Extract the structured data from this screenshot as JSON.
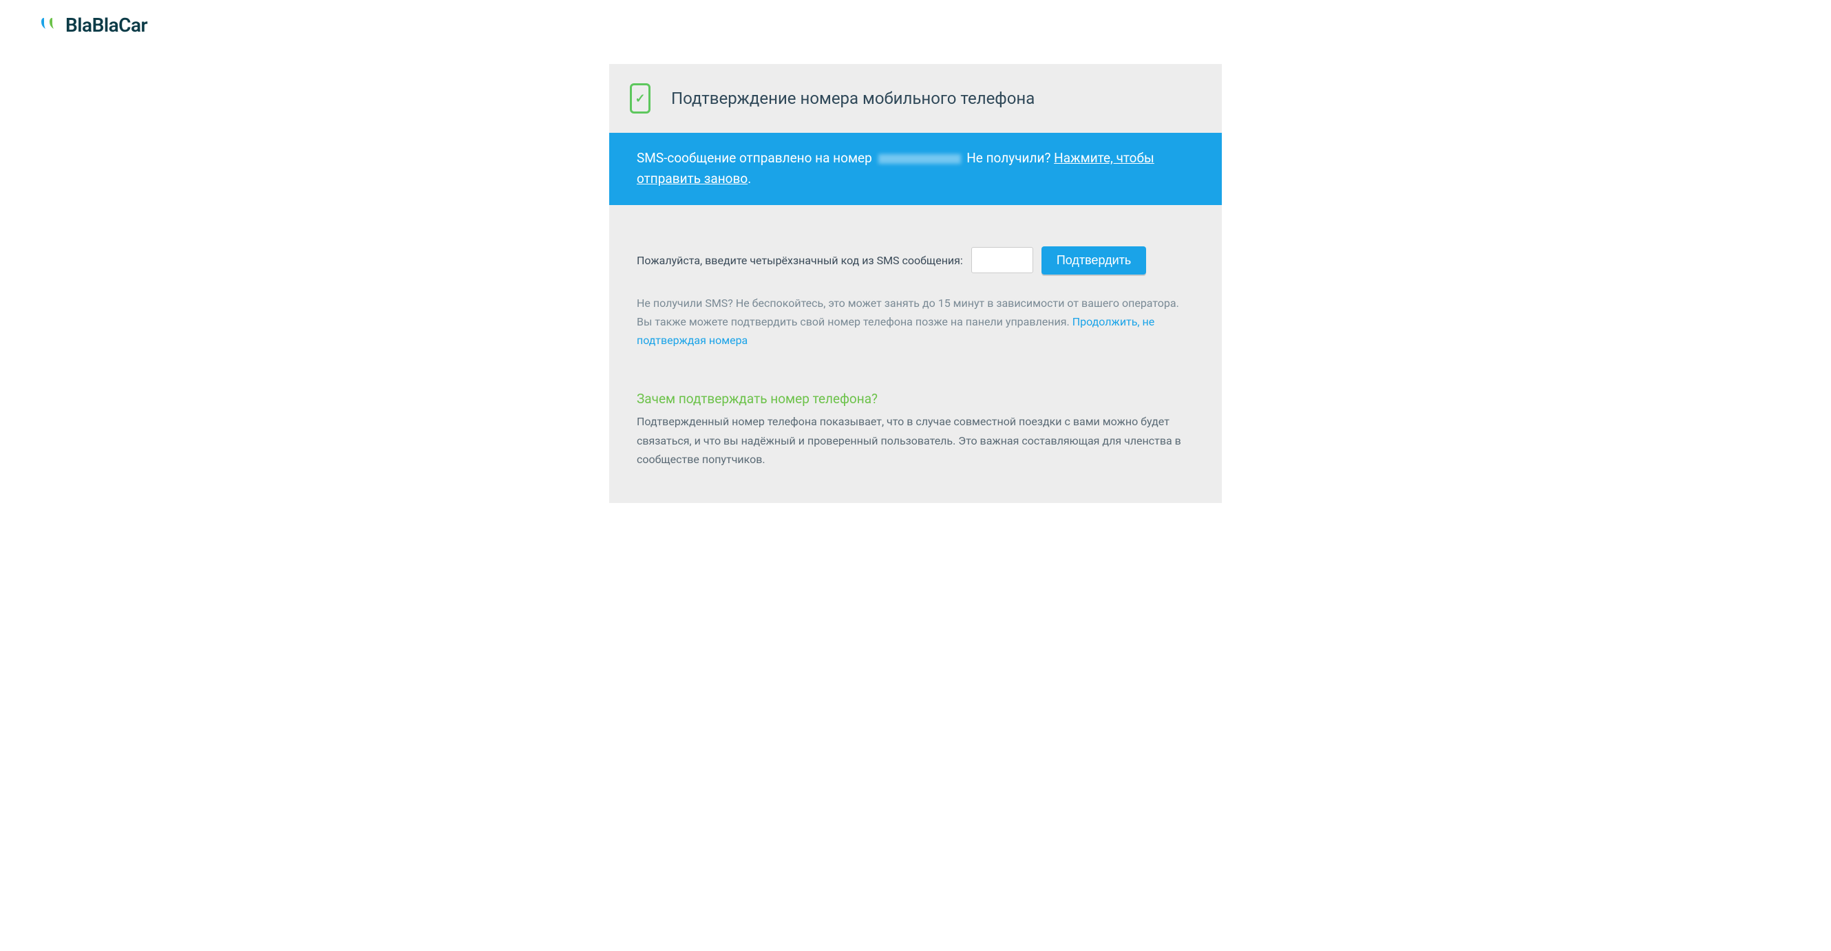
{
  "logo": {
    "text": "BlaBlaCar"
  },
  "card": {
    "title": "Подтверждение номера мобильного телефона"
  },
  "alert": {
    "sent_prefix": "SMS-сообщение отправлено на номер",
    "not_received": "Не получили?",
    "resend_link": "Нажмите, чтобы отправить заново"
  },
  "form": {
    "label": "Пожалуйста, введите четырёхзначный код из SMS сообщения:",
    "confirm_button": "Подтвердить",
    "help_text": "Не получили SMS? Не беспокойтесь, это может занять до 15 минут в зависимости от вашего оператора. Вы также можете подтвердить свой номер телефона позже на панели управления.",
    "skip_link": "Продолжить, не подтверждая номера"
  },
  "why": {
    "title": "Зачем подтверждать номер телефона?",
    "text": "Подтвержденный номер телефона показывает, что в случае совместной поездки с вами можно будет связаться, и что вы надёжный и проверенный пользователь. Это важная составляющая для членства в сообществе попутчиков."
  }
}
